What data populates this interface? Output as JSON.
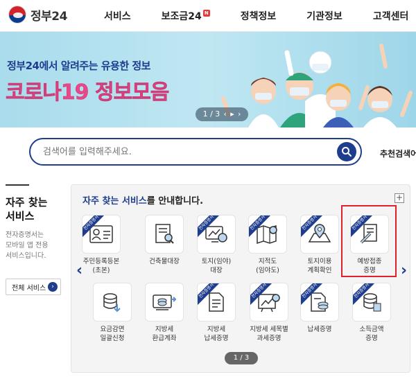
{
  "header": {
    "logo_text": "정부24",
    "nav": [
      {
        "label": "서비스"
      },
      {
        "label": "보조금24",
        "badge": "N"
      },
      {
        "label": "정책정보"
      },
      {
        "label": "기관정보"
      },
      {
        "label": "고객센터"
      }
    ]
  },
  "banner": {
    "subtitle": "정부24에서 알려주는 유용한 정보",
    "title": "코로나19 정보모음",
    "pager": {
      "current": "1 / 3",
      "prev": "‹",
      "next": "›"
    }
  },
  "search": {
    "placeholder": "검색어를 입력해주세요.",
    "recommend_label": "추천검색어"
  },
  "left_panel": {
    "title_line1": "자주 찾는",
    "title_line2": "서비스",
    "desc": [
      "전자증명서는",
      "모바일 앱 전용",
      "서비스입니다."
    ],
    "all_button": "전체 서비스",
    "arrow": "›"
  },
  "services_panel": {
    "title_highlight": "자주 찾는 서비스",
    "title_rest": "를 안내합니다.",
    "plus": "+",
    "ribbon": "전자증명서",
    "page_indicator": "1 / 3",
    "prev_arrow": "‹",
    "next_arrow": "›",
    "row1": [
      {
        "label1": "주민등록등본",
        "label2": "(초본)",
        "icon": "id-card-icon"
      },
      {
        "label1": "건축물대장",
        "label2": "",
        "icon": "document-search-icon"
      },
      {
        "label1": "토지(임야)",
        "label2": "대장",
        "icon": "land-register-icon"
      },
      {
        "label1": "지적도",
        "label2": "(임야도)",
        "icon": "map-search-icon"
      },
      {
        "label1": "토지이용",
        "label2": "계획확인",
        "icon": "map-pin-icon"
      },
      {
        "label1": "예방접종",
        "label2": "증명",
        "icon": "vaccine-certificate-icon"
      }
    ],
    "row2": [
      {
        "label1": "요금감면",
        "label2": "일괄신청",
        "icon": "coins-icon"
      },
      {
        "label1": "지방세",
        "label2": "환급계좌",
        "icon": "refund-icon"
      },
      {
        "label1": "지방세",
        "label2": "납세증명",
        "icon": "tax-document-icon"
      },
      {
        "label1": "지방세 세목별",
        "label2": "과세증명",
        "icon": "tax-chart-icon"
      },
      {
        "label1": "납세증명",
        "label2": "",
        "icon": "tax-cert-icon"
      },
      {
        "label1": "소득금액",
        "label2": "증명",
        "icon": "income-icon"
      }
    ]
  }
}
